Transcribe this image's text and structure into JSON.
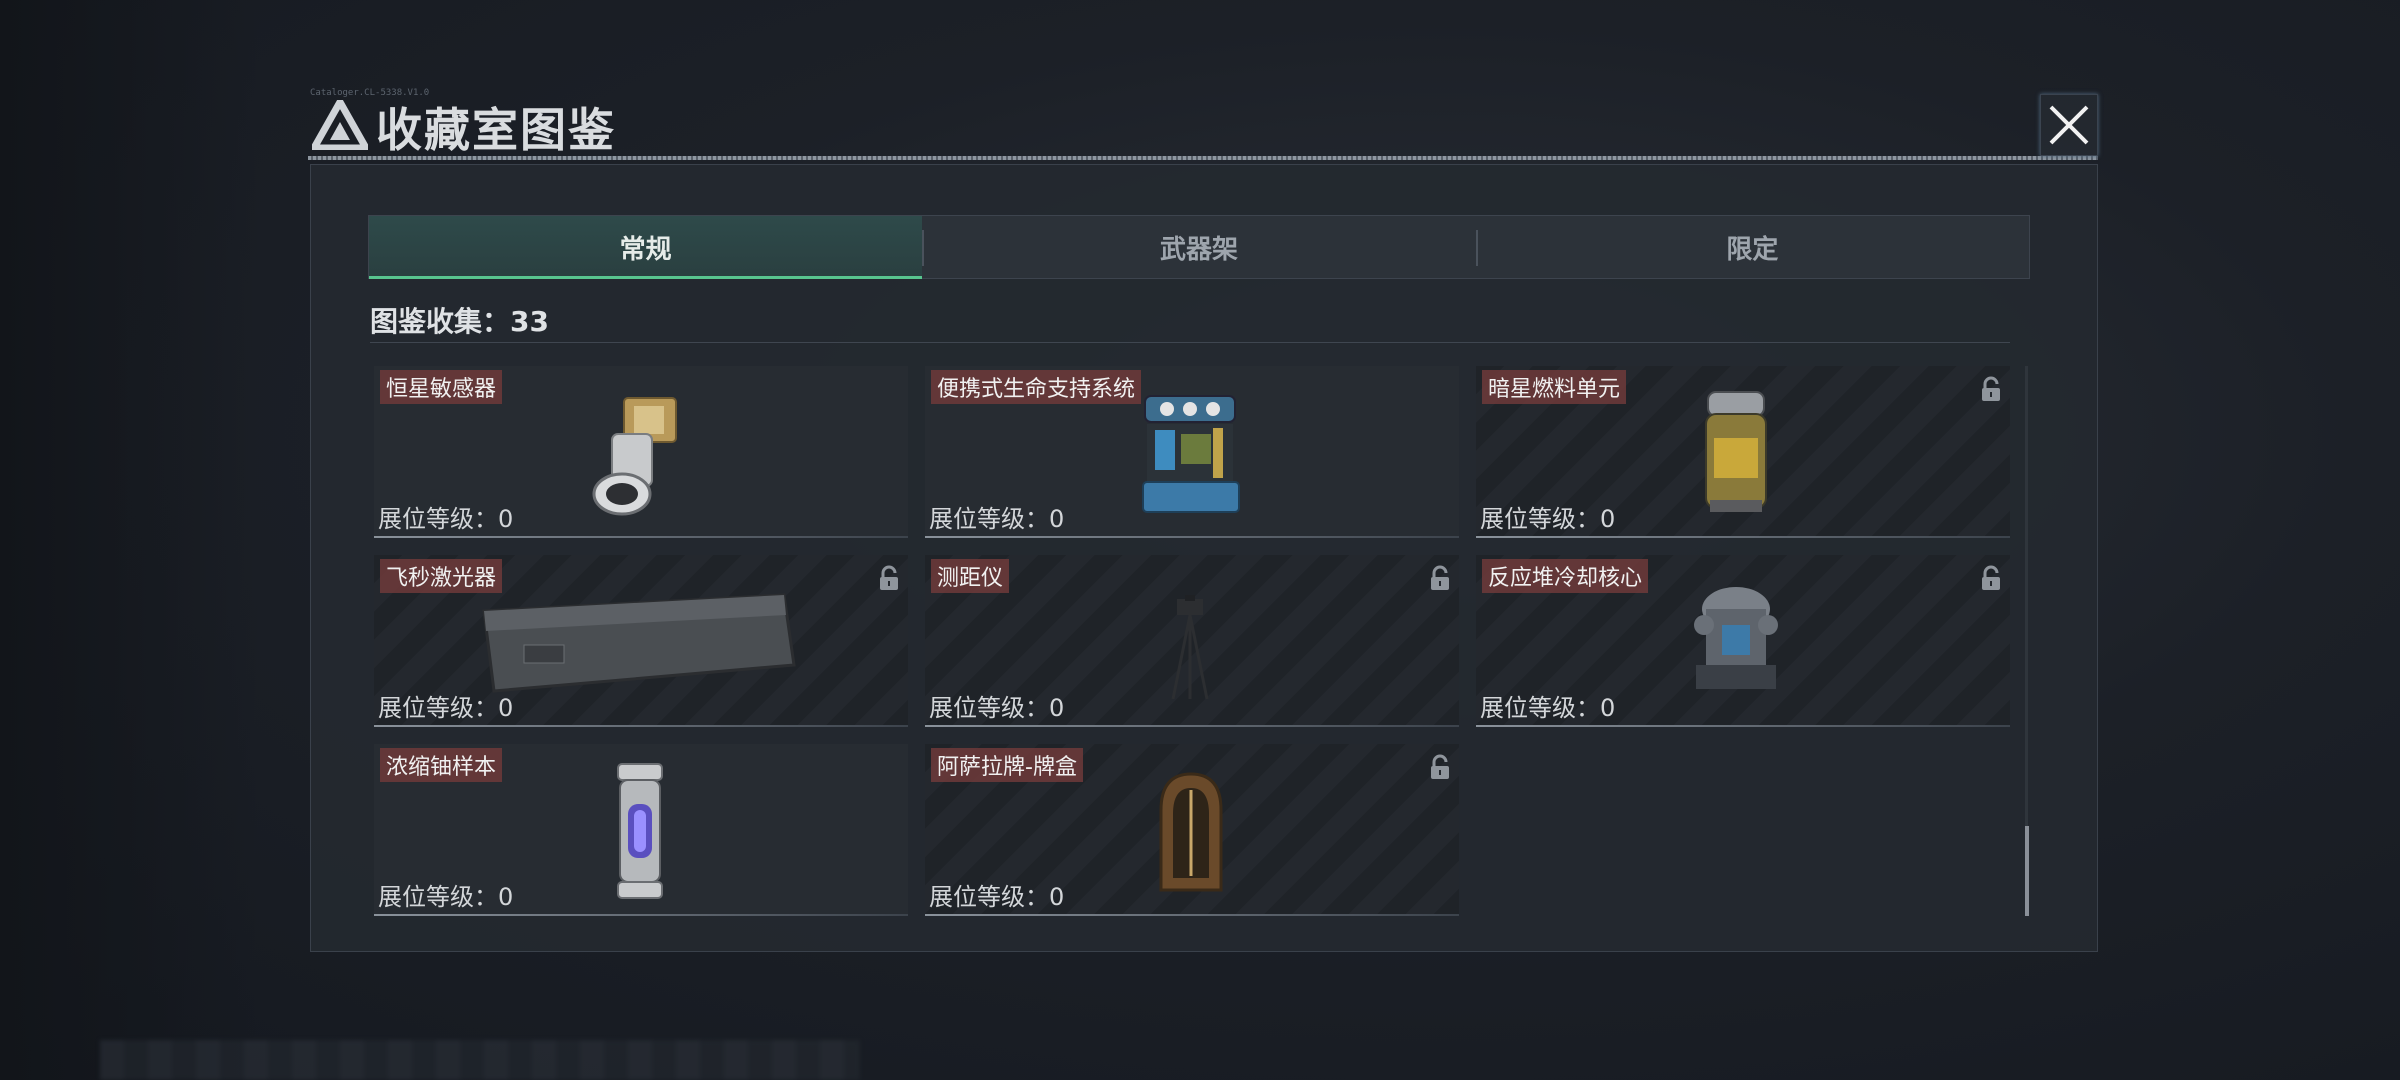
{
  "title": {
    "text": "收藏室图鉴",
    "tiny": "Cataloger.CL-5338.V1.0"
  },
  "tabs": [
    {
      "label": "常规",
      "active": true
    },
    {
      "label": "武器架",
      "active": false
    },
    {
      "label": "限定",
      "active": false
    }
  ],
  "collection": {
    "label": "图鉴收集：33"
  },
  "cards": [
    {
      "name": "恒星敏感器",
      "level": "展位等级：0",
      "locked": false,
      "icon": "star-sensor-icon"
    },
    {
      "name": "便携式生命支持系统",
      "level": "展位等级：0",
      "locked": false,
      "icon": "life-support-icon"
    },
    {
      "name": "暗星燃料单元",
      "level": "展位等级：0",
      "locked": true,
      "icon": "fuel-cell-icon"
    },
    {
      "name": "飞秒激光器",
      "level": "展位等级：0",
      "locked": true,
      "icon": "laser-case-icon"
    },
    {
      "name": "测距仪",
      "level": "展位等级：0",
      "locked": true,
      "icon": "tripod-icon"
    },
    {
      "name": "反应堆冷却核心",
      "level": "展位等级：0",
      "locked": true,
      "icon": "reactor-core-icon"
    },
    {
      "name": "浓缩铀样本",
      "level": "展位等级：0",
      "locked": false,
      "icon": "uranium-capsule-icon"
    },
    {
      "name": "阿萨拉牌-牌盒",
      "level": "展位等级：0",
      "locked": true,
      "icon": "card-box-icon"
    }
  ],
  "colors": {
    "accent": "#58c58f",
    "name_bg": "#6e3a3a",
    "panel": "#24292f"
  }
}
